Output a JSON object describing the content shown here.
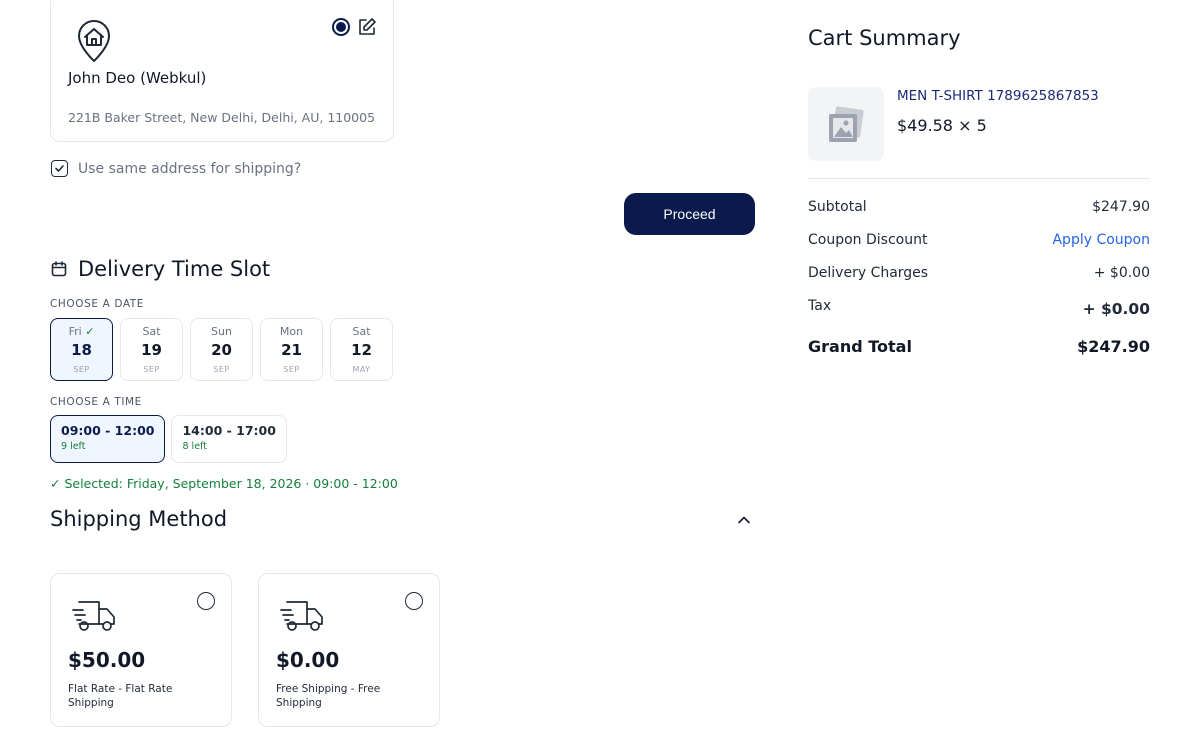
{
  "address": {
    "name": "John Deo (Webkul)",
    "line": "221B Baker Street, New Delhi, Delhi, AU, 110005",
    "same_address_label": "Use same address for shipping?"
  },
  "proceed_label": "Proceed",
  "delivery": {
    "title": "Delivery Time Slot",
    "choose_date_label": "CHOOSE A DATE",
    "dates": [
      {
        "day": "Fri",
        "num": "18",
        "month": "SEP",
        "selected": true
      },
      {
        "day": "Sat",
        "num": "19",
        "month": "SEP",
        "selected": false
      },
      {
        "day": "Sun",
        "num": "20",
        "month": "SEP",
        "selected": false
      },
      {
        "day": "Mon",
        "num": "21",
        "month": "SEP",
        "selected": false
      },
      {
        "day": "Sat",
        "num": "12",
        "month": "MAY",
        "selected": false
      }
    ],
    "choose_time_label": "CHOOSE A TIME",
    "times": [
      {
        "range": "09:00 - 12:00",
        "left": "9 left",
        "selected": true
      },
      {
        "range": "14:00 - 17:00",
        "left": "8 left",
        "selected": false
      }
    ],
    "selected_text": "✓  Selected: Friday, September 18, 2026 · 09:00 - 12:00"
  },
  "shipping": {
    "title": "Shipping Method",
    "methods": [
      {
        "price": "$50.00",
        "desc": "Flat Rate - Flat Rate Shipping",
        "icon": "truck-icon"
      },
      {
        "price": "$0.00",
        "desc": "Free Shipping - Free Shipping",
        "icon": "truck-icon"
      }
    ]
  },
  "cart": {
    "title": "Cart Summary",
    "product_name": "MEN T-SHIRT 1789625867853",
    "product_price": "$49.58 × 5",
    "subtotal_label": "Subtotal",
    "subtotal_value": "$247.90",
    "coupon_label": "Coupon Discount",
    "coupon_action": "Apply Coupon",
    "delivery_label": "Delivery Charges",
    "delivery_value": "+ $0.00",
    "tax_label": "Tax",
    "tax_value": "+ $0.00",
    "grand_label": "Grand Total",
    "grand_value": "$247.90"
  },
  "colors": {
    "primary": "#0b1a4d",
    "success": "#15803d",
    "link": "#2563eb"
  }
}
